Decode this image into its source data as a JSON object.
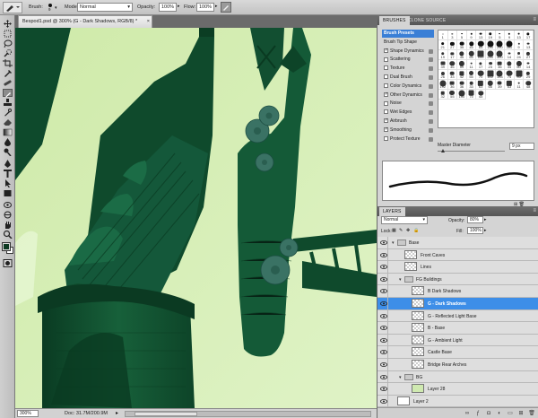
{
  "options_bar": {
    "brush_label": "Brush:",
    "brush_size": "9",
    "mode_label": "Mode:",
    "mode_value": "Normal",
    "opacity_label": "Opacity:",
    "opacity_value": "100%",
    "flow_label": "Flow:",
    "flow_value": "100%"
  },
  "document": {
    "tab_title": "Bespod1.psd @ 300% (G - Dark Shadows, RGB/8) *",
    "zoom": "300%",
    "doc_info": "Doc: 31.7M/200.9M"
  },
  "brushes_panel": {
    "tabs": [
      "BRUSHES",
      "CLONE SOURCE"
    ],
    "list": [
      {
        "label": "Brush Presets",
        "checked": null,
        "lock": false,
        "selected": true
      },
      {
        "label": "Brush Tip Shape",
        "checked": null,
        "lock": false,
        "selected": false
      },
      {
        "label": "Shape Dynamics",
        "checked": true,
        "lock": true,
        "selected": false
      },
      {
        "label": "Scattering",
        "checked": false,
        "lock": true,
        "selected": false
      },
      {
        "label": "Texture",
        "checked": false,
        "lock": true,
        "selected": false
      },
      {
        "label": "Dual Brush",
        "checked": false,
        "lock": true,
        "selected": false
      },
      {
        "label": "Color Dynamics",
        "checked": false,
        "lock": true,
        "selected": false
      },
      {
        "label": "Other Dynamics",
        "checked": true,
        "lock": true,
        "selected": false
      },
      {
        "label": "Noise",
        "checked": false,
        "lock": true,
        "selected": false
      },
      {
        "label": "Wet Edges",
        "checked": false,
        "lock": true,
        "selected": false
      },
      {
        "label": "Airbrush",
        "checked": true,
        "lock": true,
        "selected": false
      },
      {
        "label": "Smoothing",
        "checked": true,
        "lock": true,
        "selected": false
      },
      {
        "label": "Protect Texture",
        "checked": false,
        "lock": true,
        "selected": false
      }
    ],
    "preset_sizes": [
      "1",
      "3",
      "5",
      "9",
      "13",
      "19",
      "5",
      "9",
      "13",
      "17",
      "21",
      "27",
      "35",
      "45",
      "65",
      "100",
      "200",
      "300",
      "9",
      "13",
      "19",
      "17",
      "45",
      "65",
      "100",
      "200",
      "300",
      "14",
      "24",
      "27",
      "39",
      "46",
      "59",
      "11",
      "17",
      "23",
      "36",
      "44",
      "60",
      "14",
      "26",
      "33",
      "42",
      "55",
      "70",
      "112",
      "134",
      "74",
      "95",
      "29",
      "192",
      "36",
      "36",
      "33",
      "63",
      "66",
      "39",
      "63",
      "11",
      "48",
      "32",
      "55",
      "100",
      "75",
      "45"
    ],
    "master_diameter_label": "Master Diameter",
    "master_diameter_value": "9 px"
  },
  "layers_panel": {
    "tab": "LAYERS",
    "blend_mode": "Normal",
    "opacity_label": "Opacity:",
    "opacity_value": "80%",
    "lock_label": "Lock:",
    "fill_label": "Fill:",
    "fill_value": "100%",
    "layers": [
      {
        "name": "Base",
        "kind": "group",
        "indent": 0,
        "selected": false
      },
      {
        "name": "Front Caves",
        "kind": "layer",
        "indent": 1,
        "selected": false
      },
      {
        "name": "Lines",
        "kind": "layer",
        "indent": 1,
        "selected": false
      },
      {
        "name": "FG Buildings",
        "kind": "group",
        "indent": 1,
        "selected": false
      },
      {
        "name": "B Dark Shadows",
        "kind": "layer",
        "indent": 2,
        "selected": false
      },
      {
        "name": "G - Dark Shadows",
        "kind": "layer",
        "indent": 2,
        "selected": true
      },
      {
        "name": "G - Reflected Light Base",
        "kind": "layer",
        "indent": 2,
        "selected": false
      },
      {
        "name": "B - Base",
        "kind": "layer",
        "indent": 2,
        "selected": false
      },
      {
        "name": "G - Ambient Light",
        "kind": "layer",
        "indent": 2,
        "selected": false
      },
      {
        "name": "Castle Base",
        "kind": "layer",
        "indent": 2,
        "selected": false
      },
      {
        "name": "Bridge Rear Arches",
        "kind": "layer",
        "indent": 2,
        "selected": false
      },
      {
        "name": "BG",
        "kind": "group",
        "indent": 1,
        "selected": false
      },
      {
        "name": "Layer 28",
        "kind": "layer",
        "indent": 2,
        "selected": false
      },
      {
        "name": "Layer 2",
        "kind": "layer",
        "indent": 0,
        "selected": false
      }
    ]
  },
  "colors": {
    "canvas_bg": "#d3ecb2",
    "tower_dark": "#0f4a2c",
    "selection": "#3d8ee8"
  }
}
